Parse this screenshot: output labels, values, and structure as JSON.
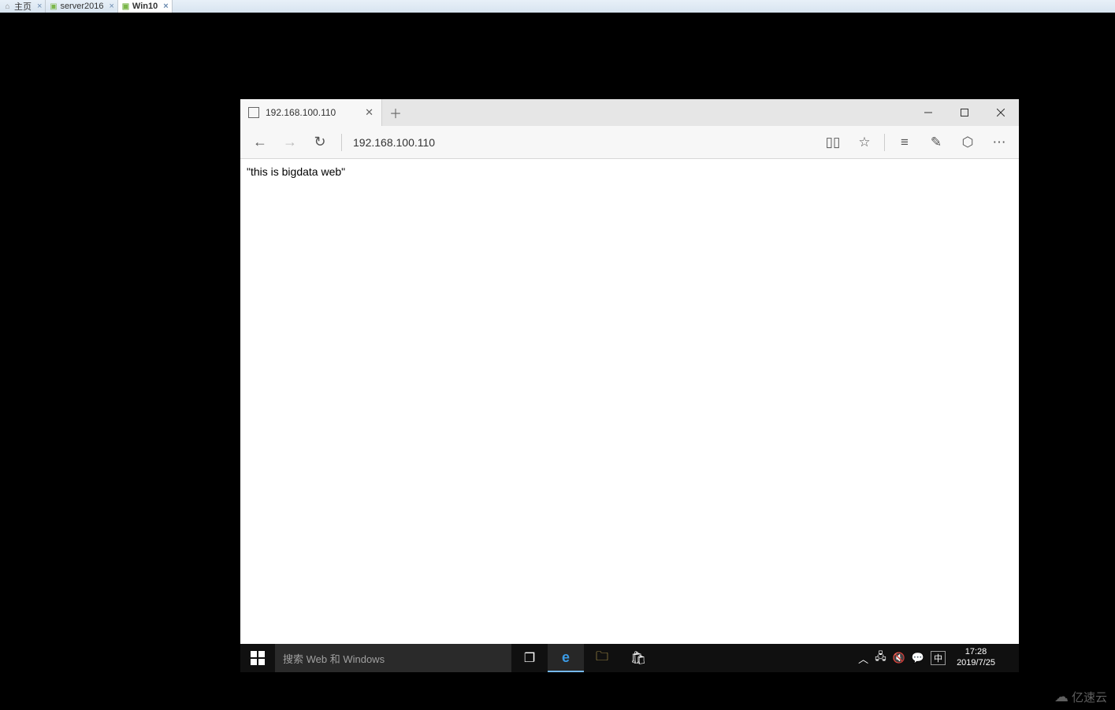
{
  "vm_tabs": [
    {
      "label": "主页",
      "icon": "home"
    },
    {
      "label": "server2016",
      "icon": "vm"
    },
    {
      "label": "Win10",
      "icon": "vm",
      "active": true
    }
  ],
  "browser": {
    "tab_title": "192.168.100.110",
    "url": "192.168.100.110",
    "page_text": "\"this is bigdata web\""
  },
  "taskbar": {
    "search_placeholder": "搜索 Web 和 Windows",
    "ime": "中",
    "time": "17:28",
    "date": "2019/7/25"
  },
  "watermark": "亿速云"
}
